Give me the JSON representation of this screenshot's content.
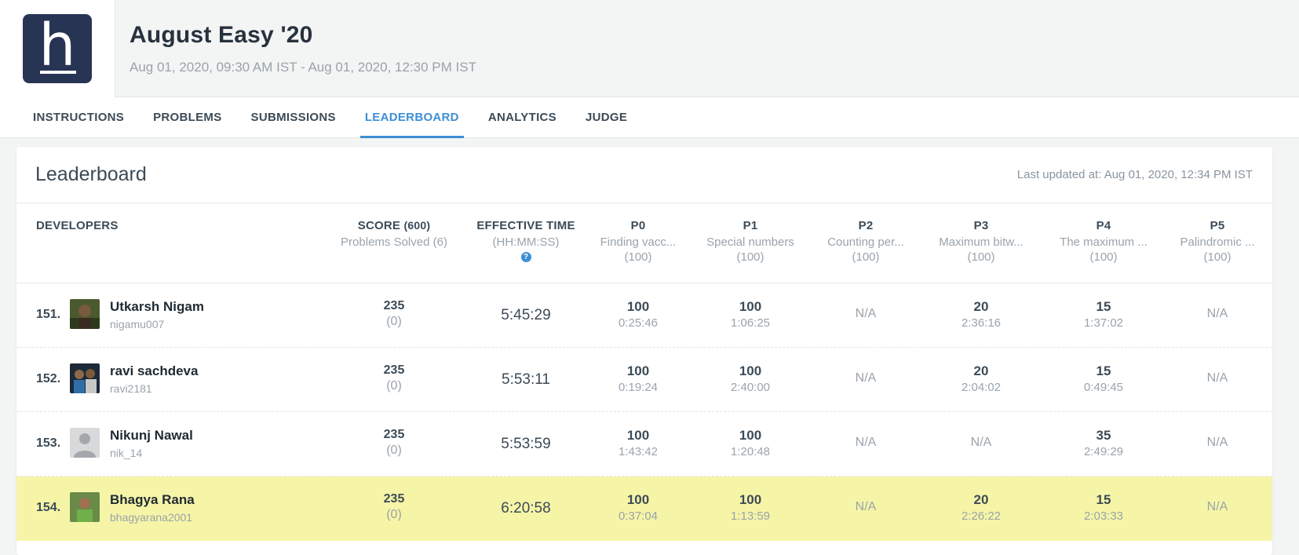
{
  "contest": {
    "title": "August Easy '20",
    "dates": "Aug 01, 2020, 09:30 AM IST - Aug 01, 2020, 12:30 PM IST"
  },
  "tabs": [
    {
      "label": "INSTRUCTIONS",
      "active": false
    },
    {
      "label": "PROBLEMS",
      "active": false
    },
    {
      "label": "SUBMISSIONS",
      "active": false
    },
    {
      "label": "LEADERBOARD",
      "active": true
    },
    {
      "label": "ANALYTICS",
      "active": false
    },
    {
      "label": "JUDGE",
      "active": false
    }
  ],
  "leaderboard": {
    "title": "Leaderboard",
    "last_updated": "Last updated at: Aug 01, 2020, 12:34 PM IST",
    "headers": {
      "developers": "DEVELOPERS",
      "score": "SCORE",
      "score_max": "(600)",
      "problems_solved": "Problems Solved (6)",
      "effective_time": "EFFECTIVE TIME",
      "time_format": "(HH:MM:SS)",
      "help_icon": "?",
      "problems": [
        {
          "code": "P0",
          "name": "Finding vacc...",
          "points": "(100)"
        },
        {
          "code": "P1",
          "name": "Special numbers",
          "points": "(100)"
        },
        {
          "code": "P2",
          "name": "Counting per...",
          "points": "(100)"
        },
        {
          "code": "P3",
          "name": "Maximum bitw...",
          "points": "(100)"
        },
        {
          "code": "P4",
          "name": "The maximum ...",
          "points": "(100)"
        },
        {
          "code": "P5",
          "name": "Palindromic ...",
          "points": "(100)"
        }
      ]
    },
    "rows": [
      {
        "rank": "151.",
        "name": "Utkarsh Nigam",
        "handle": "nigamu007",
        "score": "235",
        "solved": "(0)",
        "time": "5:45:29",
        "highlight": false,
        "avatar": "photo-dark",
        "problems": [
          {
            "score": "100",
            "time": "0:25:46"
          },
          {
            "score": "100",
            "time": "1:06:25"
          },
          {
            "score": "N/A",
            "time": ""
          },
          {
            "score": "20",
            "time": "2:36:16"
          },
          {
            "score": "15",
            "time": "1:37:02"
          },
          {
            "score": "N/A",
            "time": ""
          }
        ]
      },
      {
        "rank": "152.",
        "name": "ravi sachdeva",
        "handle": "ravi2181",
        "score": "235",
        "solved": "(0)",
        "time": "5:53:11",
        "highlight": false,
        "avatar": "photo-group",
        "problems": [
          {
            "score": "100",
            "time": "0:19:24"
          },
          {
            "score": "100",
            "time": "2:40:00"
          },
          {
            "score": "N/A",
            "time": ""
          },
          {
            "score": "20",
            "time": "2:04:02"
          },
          {
            "score": "15",
            "time": "0:49:45"
          },
          {
            "score": "N/A",
            "time": ""
          }
        ]
      },
      {
        "rank": "153.",
        "name": "Nikunj Nawal",
        "handle": "nik_14",
        "score": "235",
        "solved": "(0)",
        "time": "5:53:59",
        "highlight": false,
        "avatar": "default-silhouette",
        "problems": [
          {
            "score": "100",
            "time": "1:43:42"
          },
          {
            "score": "100",
            "time": "1:20:48"
          },
          {
            "score": "N/A",
            "time": ""
          },
          {
            "score": "N/A",
            "time": ""
          },
          {
            "score": "35",
            "time": "2:49:29"
          },
          {
            "score": "N/A",
            "time": ""
          }
        ]
      },
      {
        "rank": "154.",
        "name": "Bhagya Rana",
        "handle": "bhagyarana2001",
        "score": "235",
        "solved": "(0)",
        "time": "6:20:58",
        "highlight": true,
        "avatar": "photo-green",
        "problems": [
          {
            "score": "100",
            "time": "0:37:04"
          },
          {
            "score": "100",
            "time": "1:13:59"
          },
          {
            "score": "N/A",
            "time": ""
          },
          {
            "score": "20",
            "time": "2:26:22"
          },
          {
            "score": "15",
            "time": "2:03:33"
          },
          {
            "score": "N/A",
            "time": ""
          }
        ]
      }
    ]
  },
  "colors": {
    "accent": "#3d8fd5",
    "logo_bg": "#283454",
    "highlight_row": "#f6f5a7"
  }
}
